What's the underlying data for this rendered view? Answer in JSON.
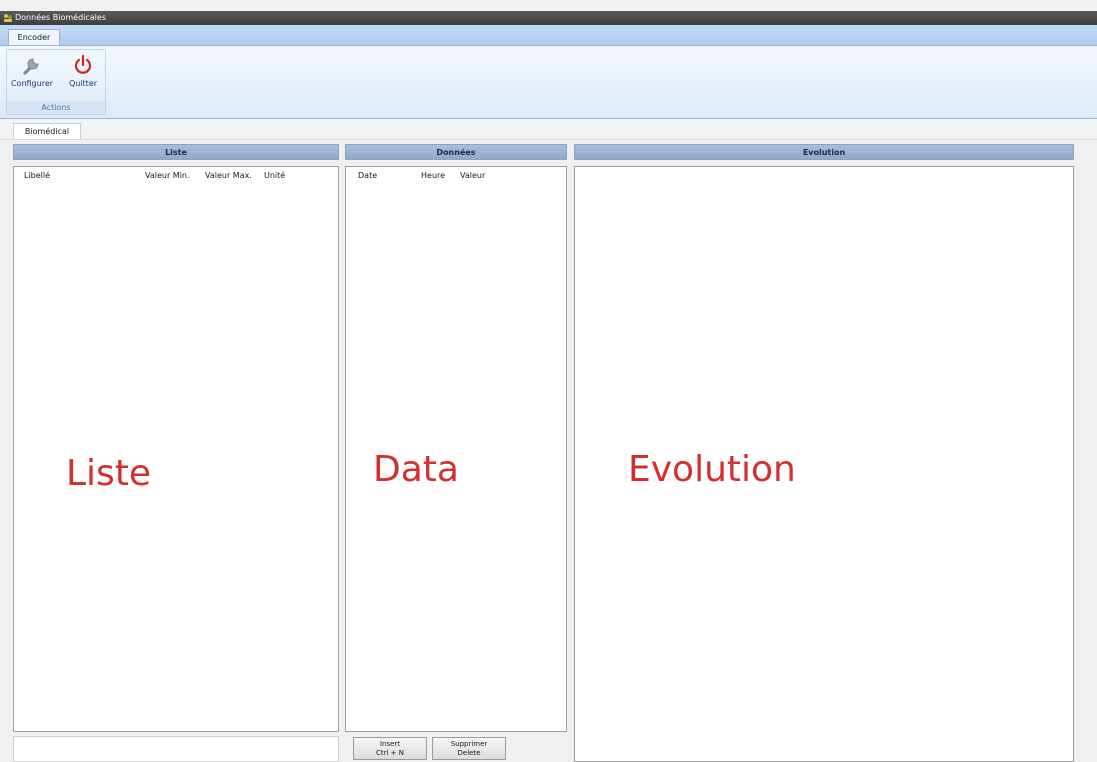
{
  "window": {
    "title": "Données Biomédicales"
  },
  "ribbon": {
    "tab_label": "Encoder",
    "configure_label": "Configurer",
    "quit_label": "Quitter",
    "group_label": "Actions"
  },
  "doc_tab": {
    "label": "Biomédical"
  },
  "liste": {
    "header": "Liste",
    "columns": [
      "Libellé",
      "Valeur Min.",
      "Valeur Max.",
      "Unité"
    ],
    "watermark": "Liste"
  },
  "donnees": {
    "header": "Données",
    "columns": [
      "Date",
      "Heure",
      "Valeur"
    ],
    "watermark": "Data",
    "insert_button": {
      "line1": "Insert",
      "line2": "Ctrl + N"
    },
    "delete_button": {
      "line1": "Supprimer",
      "line2": "Delete"
    }
  },
  "evolution": {
    "header": "Evolution",
    "watermark": "Evolution"
  },
  "colors": {
    "panel_header": "#98b1cf",
    "ribbon": "#dde9f7",
    "watermark": "#d32f2f",
    "quit_icon": "#c62828"
  },
  "icons": [
    "app-icon",
    "wrench-icon",
    "power-icon"
  ]
}
